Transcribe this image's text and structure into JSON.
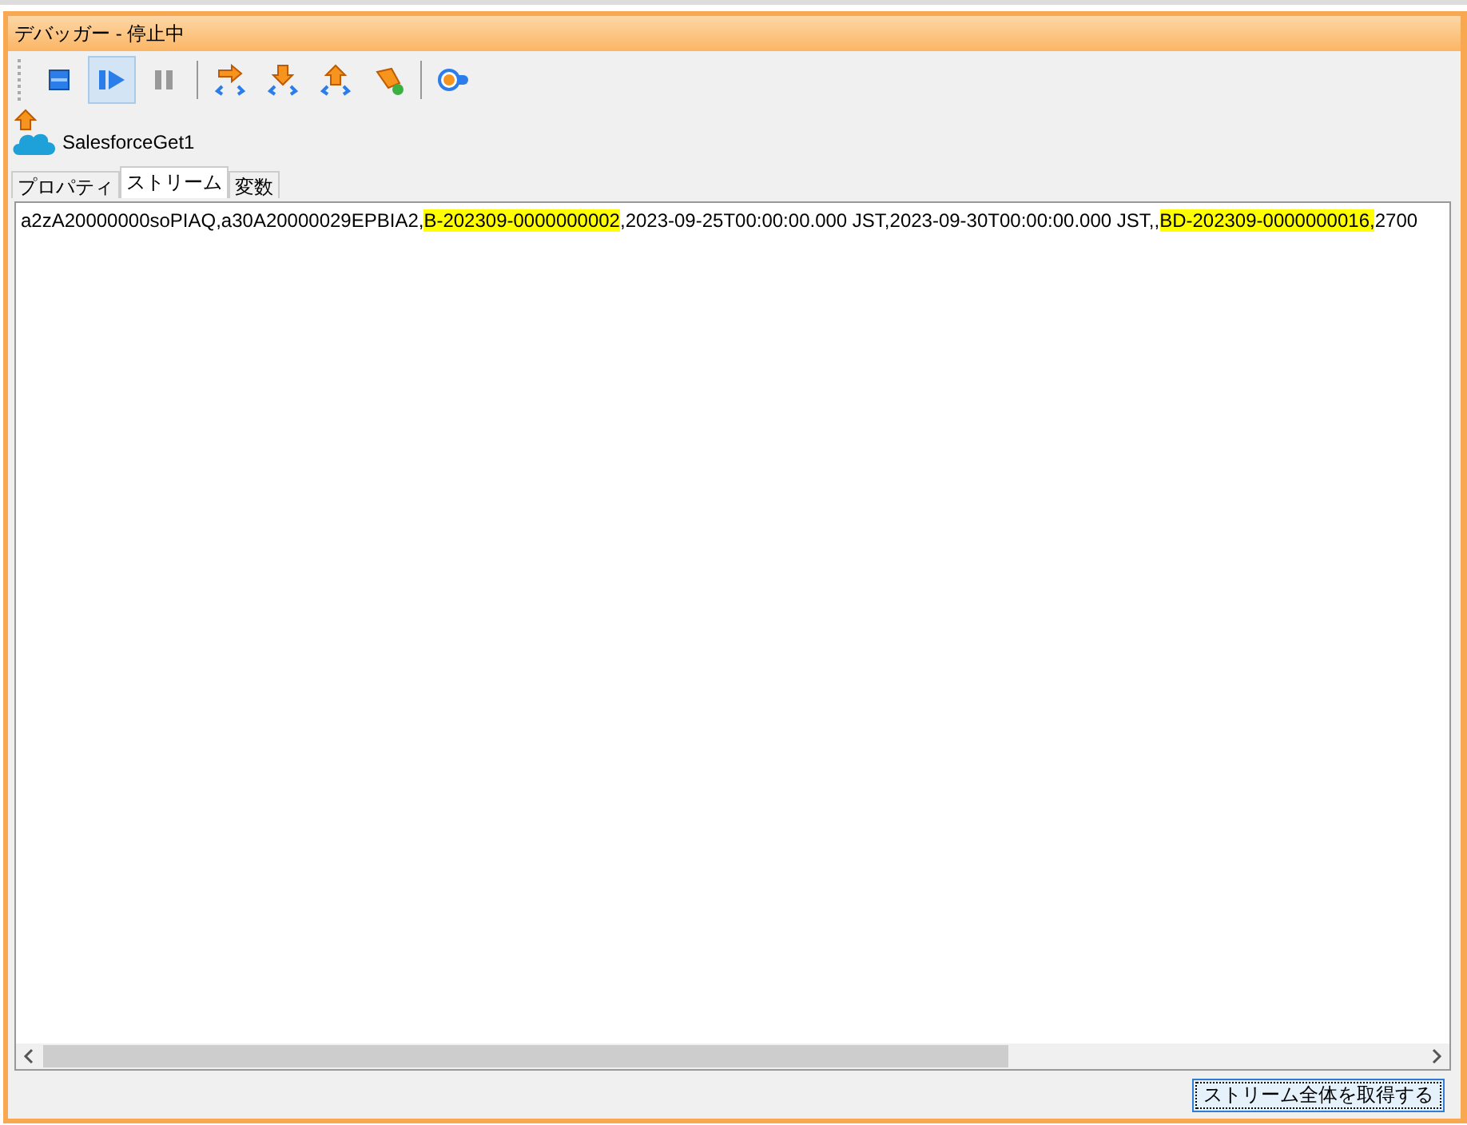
{
  "window": {
    "title": "デバッガー - 停止中"
  },
  "toolbar": {
    "buttons": [
      {
        "kind": "stop",
        "selected": false
      },
      {
        "kind": "resume",
        "selected": true
      },
      {
        "kind": "pause",
        "selected": false
      },
      {
        "kind": "step-over",
        "selected": false
      },
      {
        "kind": "step-into",
        "selected": false
      },
      {
        "kind": "step-out",
        "selected": false
      },
      {
        "kind": "clear",
        "selected": false
      },
      {
        "kind": "breakpoint",
        "selected": false
      }
    ]
  },
  "node": {
    "label": "SalesforceGet1"
  },
  "tabs": [
    {
      "label": "プロパティ",
      "selected": false
    },
    {
      "label": "ストリーム",
      "selected": true
    },
    {
      "label": "変数",
      "selected": false
    }
  ],
  "stream": {
    "segments": [
      {
        "text": "a2zA20000000soPIAQ,a30A20000029EPBIA2,",
        "highlighted": false
      },
      {
        "text": "B-202309-0000000002",
        "highlighted": true
      },
      {
        "text": ",2023-09-25T00:00:00.000 JST,2023-09-30T00:00:00.000 JST,,",
        "highlighted": false
      },
      {
        "text": "BD-202309-0000000016,",
        "highlighted": true
      },
      {
        "text": "2700",
        "highlighted": false
      }
    ]
  },
  "buttons": [
    "ストリーム全体を取得する"
  ]
}
